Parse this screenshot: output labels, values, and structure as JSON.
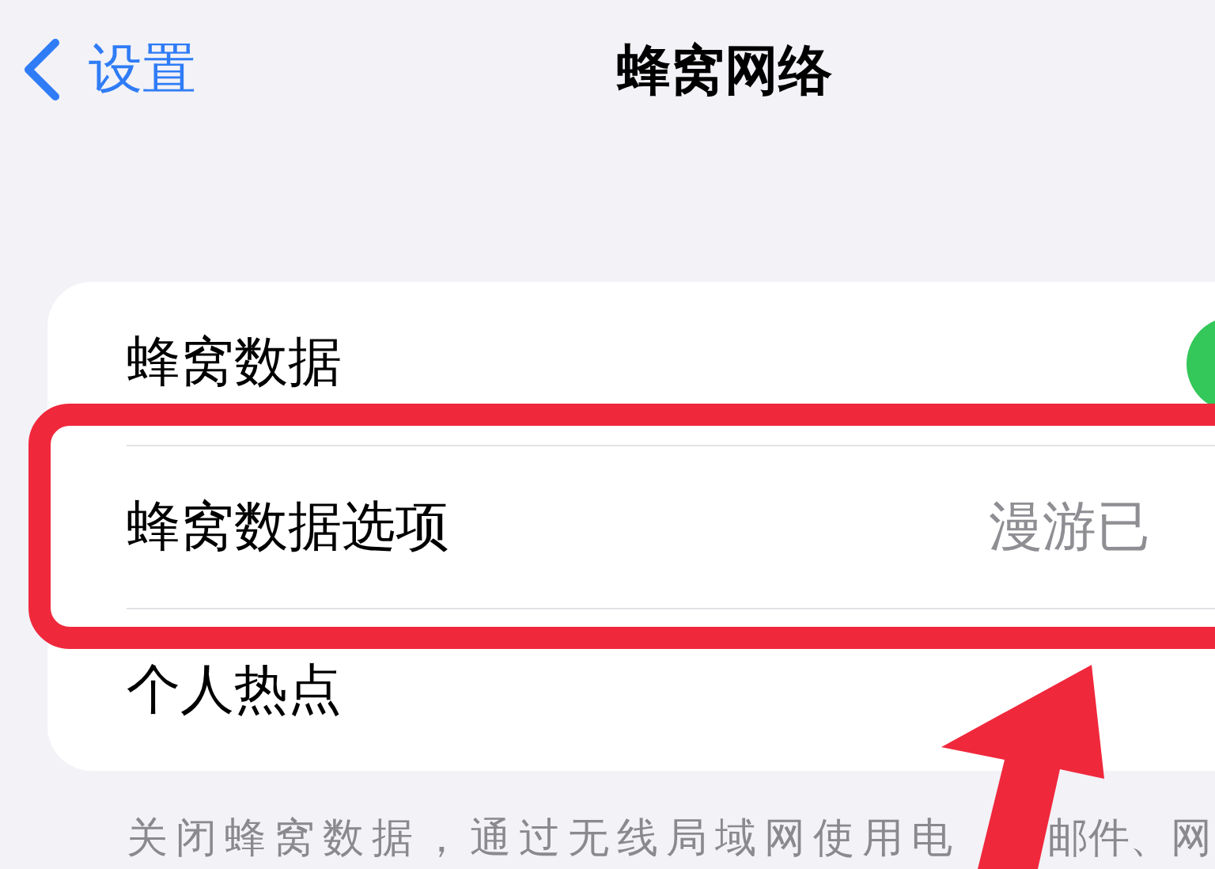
{
  "nav": {
    "back_label": "设置",
    "title": "蜂窝网络"
  },
  "rows": [
    {
      "kind": "toggle",
      "label": "蜂窝数据",
      "on": true
    },
    {
      "kind": "value",
      "label": "蜂窝数据选项",
      "value": "漫游已"
    },
    {
      "kind": "value",
      "label": "个人热点"
    }
  ],
  "footer": [
    "关闭蜂窝数据，通过无线局域网使用电",
    "邮件、网"
  ]
}
